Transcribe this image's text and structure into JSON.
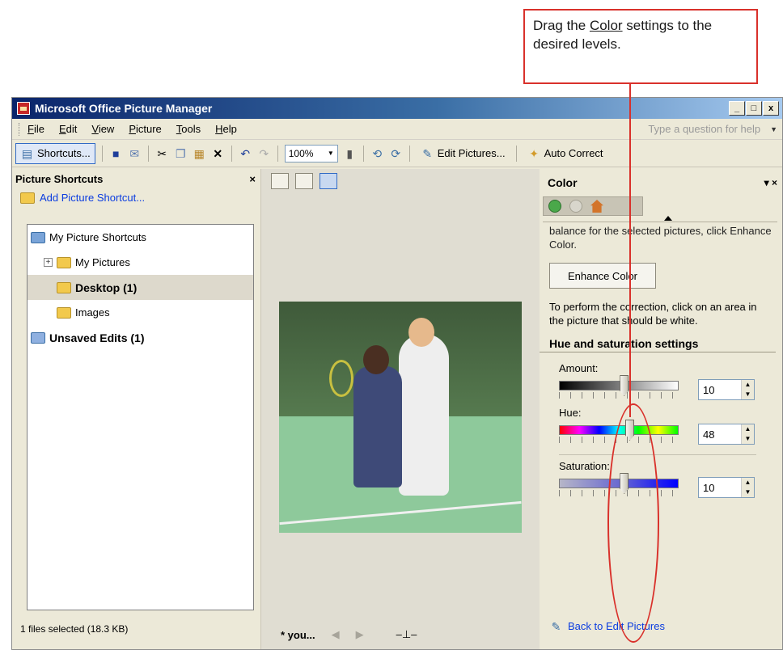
{
  "callout": {
    "text_before": "Drag the ",
    "underlined": "Color",
    "text_after": " settings to the desired levels."
  },
  "window": {
    "title": "Microsoft Office Picture Manager",
    "title_buttons": [
      "_",
      "□",
      "x"
    ]
  },
  "menu": {
    "items": [
      "File",
      "Edit",
      "View",
      "Picture",
      "Tools",
      "Help"
    ],
    "help_placeholder": "Type a question for help"
  },
  "toolbar": {
    "shortcuts_label": "Shortcuts...",
    "zoom": "100%",
    "edit_pictures_label": "Edit Pictures...",
    "auto_correct_label": "Auto Correct"
  },
  "left_pane": {
    "title": "Picture Shortcuts",
    "add_shortcut": "Add Picture Shortcut...",
    "tree": [
      {
        "label": "My Picture Shortcuts"
      },
      {
        "label": "My Pictures"
      },
      {
        "label": "Desktop (1)"
      },
      {
        "label": "Images"
      },
      {
        "label": "Unsaved Edits (1)"
      }
    ],
    "status": "1 files selected (18.3 KB)"
  },
  "center": {
    "filename": "* you..."
  },
  "task_pane": {
    "title": "Color",
    "cut_text": "balance for the selected pictures, click Enhance Color.",
    "enhance_button": "Enhance Color",
    "correction_text": "To perform the correction, click on an area in the picture that should be white.",
    "section_title": "Hue and saturation settings",
    "sliders": [
      {
        "label": "Amount:",
        "value": "10",
        "fraction": 0.55
      },
      {
        "label": "Hue:",
        "value": "48",
        "fraction": 0.6
      },
      {
        "label": "Saturation:",
        "value": "10",
        "fraction": 0.55
      }
    ],
    "back_link": "Back to Edit Pictures"
  }
}
